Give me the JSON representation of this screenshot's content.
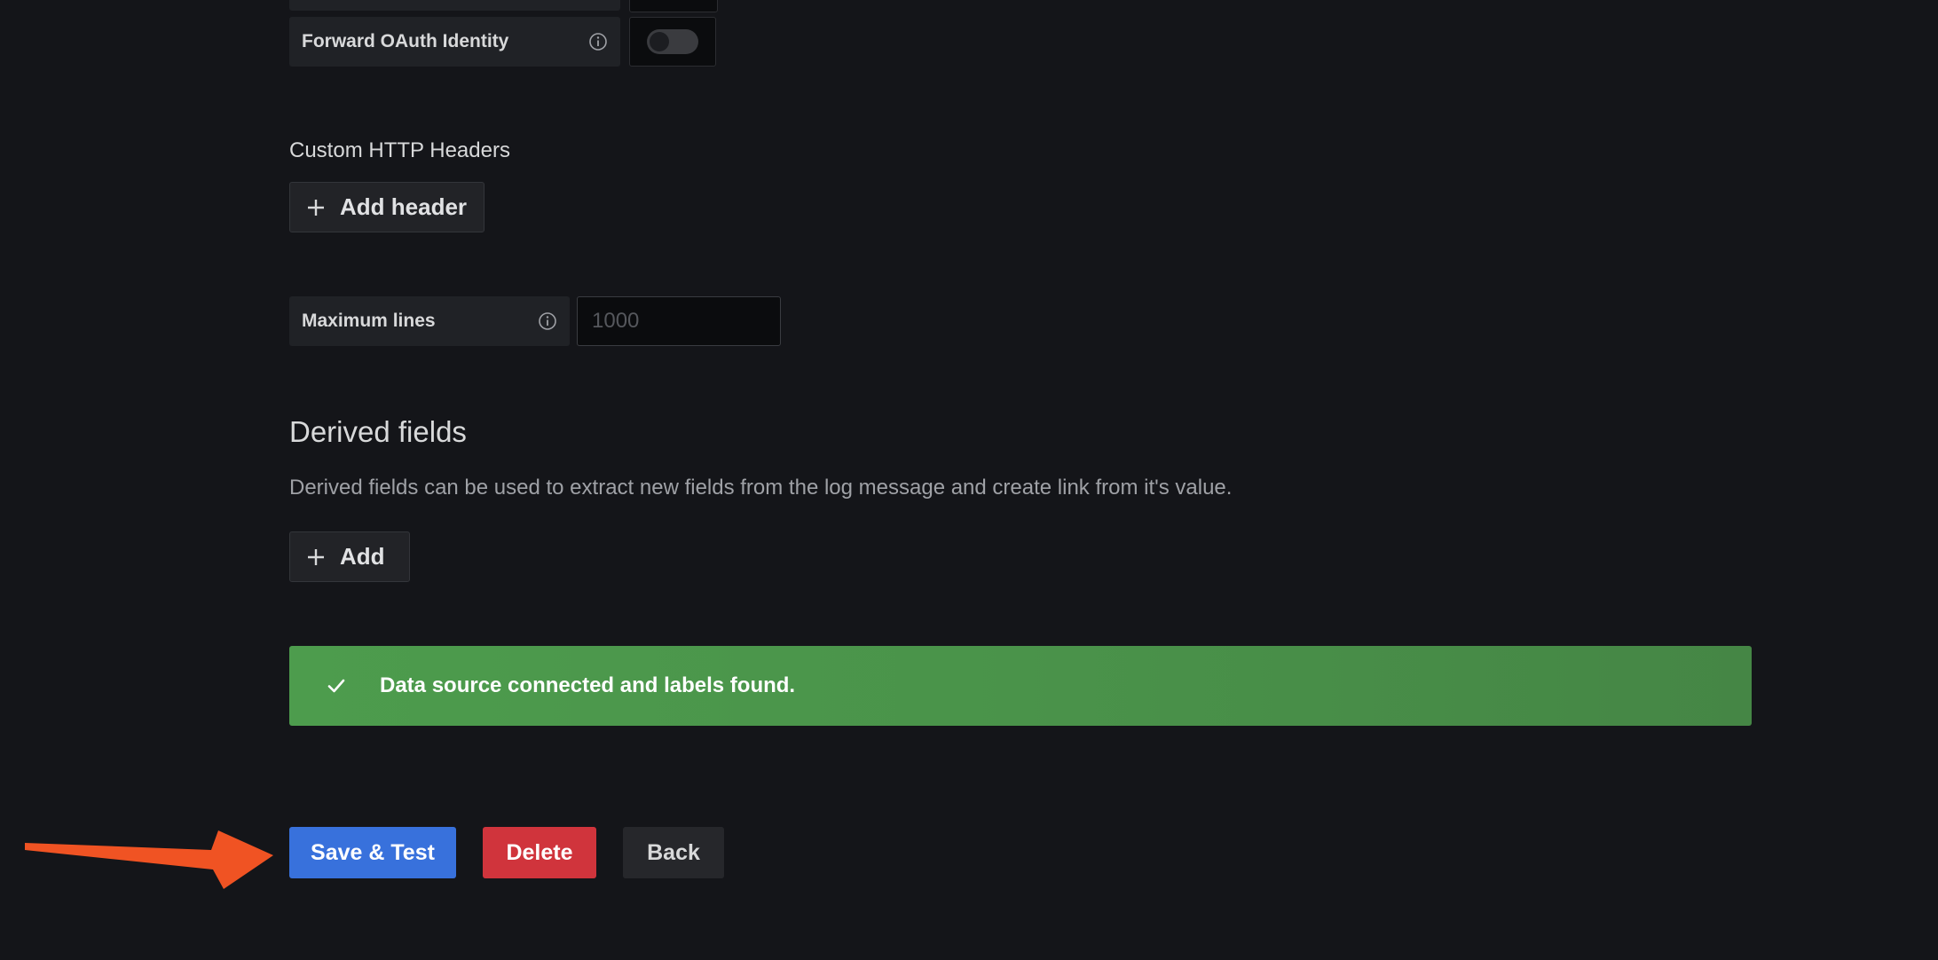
{
  "oauth": {
    "label": "Forward OAuth Identity",
    "toggle_on": false
  },
  "custom_headers": {
    "title": "Custom HTTP Headers",
    "add_label": "Add header"
  },
  "max_lines": {
    "label": "Maximum lines",
    "placeholder": "1000",
    "value": ""
  },
  "derived_fields": {
    "title": "Derived fields",
    "description": "Derived fields can be used to extract new fields from the log message and create link from it's value.",
    "add_label": "Add"
  },
  "alert": {
    "message": "Data source connected and labels found.",
    "color": "#4a934a"
  },
  "actions": {
    "save_label": "Save & Test",
    "delete_label": "Delete",
    "back_label": "Back"
  },
  "colors": {
    "primary": "#3871dc",
    "danger": "#d0343c",
    "success": "#4a934a",
    "annotation_arrow": "#f05323"
  },
  "icons": {
    "info": "info-circle-icon",
    "plus": "plus-icon",
    "check": "check-icon",
    "arrow": "arrow-right-icon"
  }
}
